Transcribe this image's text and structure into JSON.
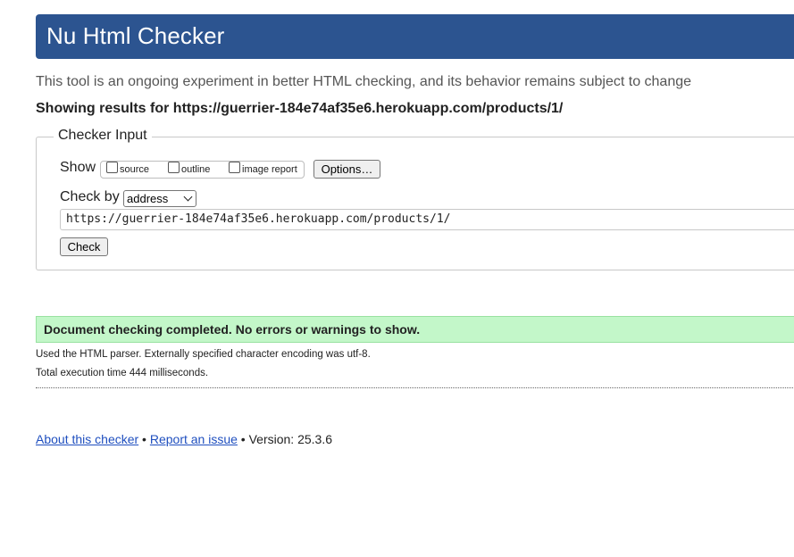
{
  "header": {
    "title": "Nu Html Checker"
  },
  "intro": "This tool is an ongoing experiment in better HTML checking, and its behavior remains subject to change",
  "showing_results": "Showing results for https://guerrier-184e74af35e6.herokuapp.com/products/1/",
  "checker_input": {
    "legend": "Checker Input",
    "show_label": "Show",
    "options": [
      {
        "label": "source",
        "checked": false
      },
      {
        "label": "outline",
        "checked": false
      },
      {
        "label": "image report",
        "checked": false
      }
    ],
    "options_button": "Options…",
    "check_by_label": "Check by",
    "check_by_value": "address",
    "url_value": "https://guerrier-184e74af35e6.herokuapp.com/products/1/",
    "check_button": "Check"
  },
  "result": {
    "message": "Document checking completed. No errors or warnings to show.",
    "parser_note": "Used the HTML parser. Externally specified character encoding was utf-8.",
    "execution_time": "Total execution time 444 milliseconds."
  },
  "footer": {
    "about_link": "About this checker",
    "separator": " • ",
    "report_link": "Report an issue",
    "version": " • Version: 25.3.6"
  },
  "colors": {
    "header_bg": "#2c5490",
    "success_bg": "#c3f7c9",
    "link": "#1f4fbf"
  }
}
